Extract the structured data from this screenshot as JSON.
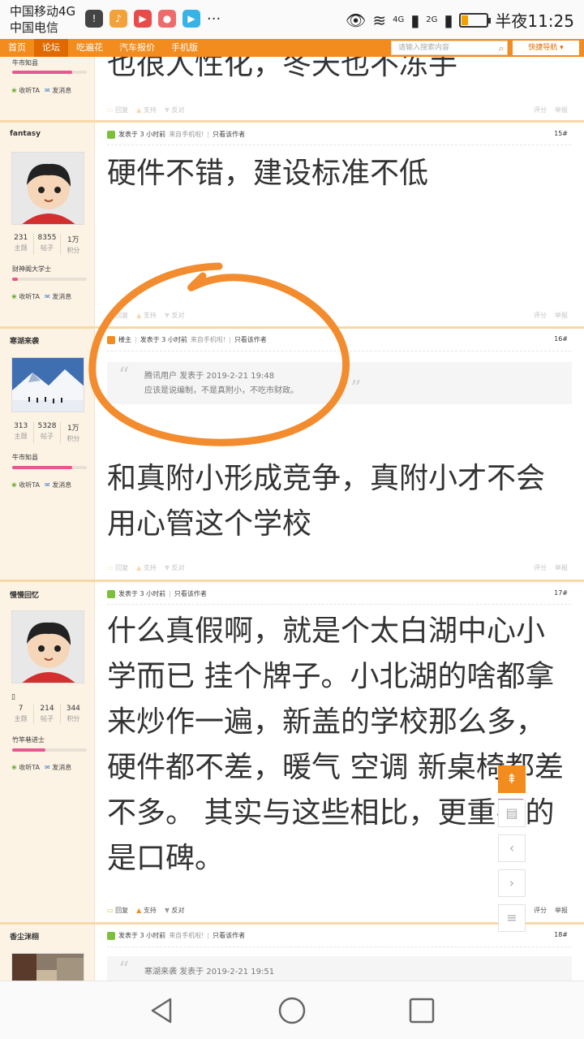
{
  "status_bar": {
    "carrier1": "中国移动4G",
    "carrier2": "中国电信",
    "signal1": "4G",
    "signal2": "2G",
    "time": "半夜11:25",
    "battery_level": 0.25,
    "accent": "#f0a000"
  },
  "nav": {
    "items": [
      "首页",
      "论坛",
      "吃遍花",
      "汽车报价",
      "手机版"
    ],
    "active_index": 1,
    "search_placeholder": "请输入搜索内容",
    "quick_nav": "快捷导航",
    "accent": "#f28c1e"
  },
  "common": {
    "follow": "收听TA",
    "message": "发消息",
    "reply": "回复",
    "support": "支持",
    "oppose": "反对",
    "rate": "评分",
    "report": "举报",
    "only_author": "只看该作者",
    "from_mobile": "来自手机啦!",
    "stat_labels": [
      "主题",
      "帖子",
      "积分"
    ]
  },
  "prev_post": {
    "rank": "牛市知县",
    "text": "也很人性化，冬天也不冻手"
  },
  "posts": [
    {
      "author": "fantasy",
      "avatar_icon": "cartoon-boy-avatar",
      "stats": [
        "231",
        "8355",
        "1万"
      ],
      "rank": "财神阁大学士",
      "meta": "发表于 3 小时前",
      "floor": "15#",
      "text": "硬件不错，建设标准不低"
    },
    {
      "author": "寒湖来袭",
      "avatar_icon": "snow-mountain-photo",
      "stats": [
        "313",
        "5328",
        "1万"
      ],
      "rank": "牛市知县",
      "owner": "楼主",
      "meta": "发表于 3 小时前",
      "floor": "16#",
      "quote_head": "腾讯用户 发表于 2019-2-21 19:48",
      "quote_body": "应该是说编制，不是真附小，不吃市财政。",
      "text": "和真附小形成竞争，真附小才不会用心管这个学校"
    },
    {
      "author": "慢慢回忆",
      "avatar_icon": "cartoon-boy-avatar",
      "stats": [
        "7",
        "214",
        "344"
      ],
      "rank": "竹竿巷进士",
      "meta": "发表于 3 小时前",
      "floor": "17#",
      "text": "什么真假啊，就是个太白湖中心小学而已 挂个牌子。小北湖的啥都拿来炒作一遍，新盖的学校那么多，硬件都不差，暖气 空调 新桌椅都差不多。 其实与这些相比，更重要的是口碑。"
    },
    {
      "author": "香尘洣栩",
      "avatar_icon": "street-photo",
      "meta": "发表于 3 小时前",
      "floor": "18#",
      "quote_head": "寒湖来袭 发表于 2019-2-21 19:51"
    }
  ]
}
